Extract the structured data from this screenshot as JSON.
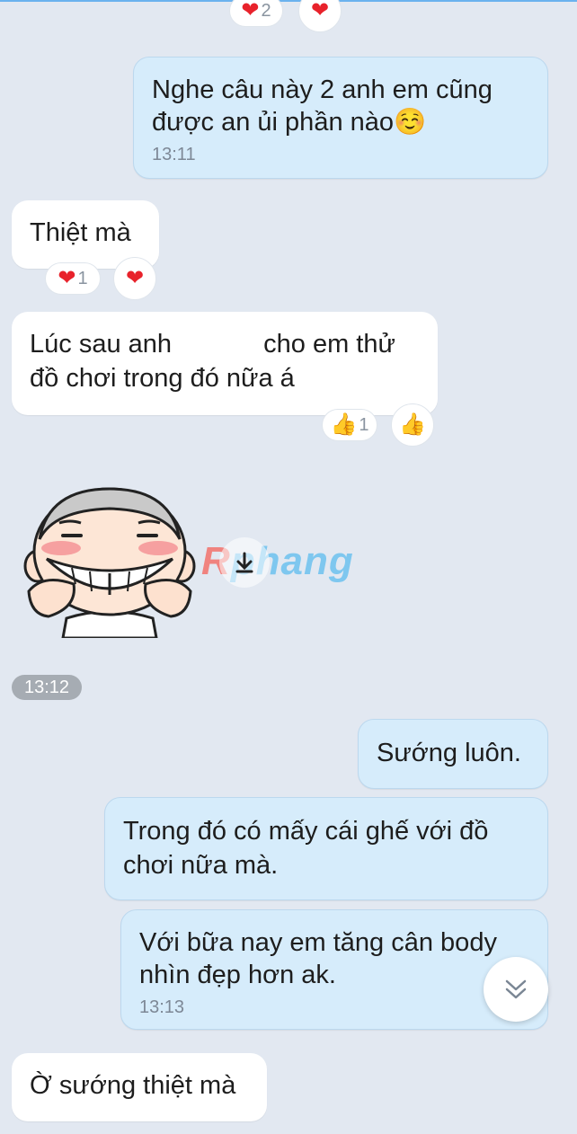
{
  "messages": [
    {
      "text": "Nghe câu này 2 anh em cũng\nđược an ủi phần nào☺️",
      "time": "13:11"
    },
    {
      "text": "Thiệt mà",
      "reaction_count": "1"
    },
    {
      "text_before": "Lúc sau anh ",
      "text_after": " cho em thử\nđồ chơi trong đó nữa á",
      "reaction_count": "1"
    },
    {
      "text": "Sướng luôn."
    },
    {
      "text": "Trong đó có mấy cái ghế với đồ\nchơi nữa mà."
    },
    {
      "text": "Với bữa nay em tăng cân body\nnhìn đẹp hơn ak.",
      "time": "13:13"
    },
    {
      "text": "Ờ sướng thiệt mà"
    }
  ],
  "top_reaction_count": "2",
  "time_divider": "13:12",
  "watermark": {
    "first": "R",
    "rest": "phang"
  },
  "icons": {
    "heart": "heart-icon",
    "thumb": "thumbs-up-icon",
    "scroll": "chevron-double-down-icon",
    "download": "download-icon",
    "sticker": "grinning-baby-sticker"
  },
  "colors": {
    "outgoing": "#d6ecfb",
    "incoming": "#ffffff",
    "background": "#e2e8f1",
    "heart": "#e8222b"
  }
}
